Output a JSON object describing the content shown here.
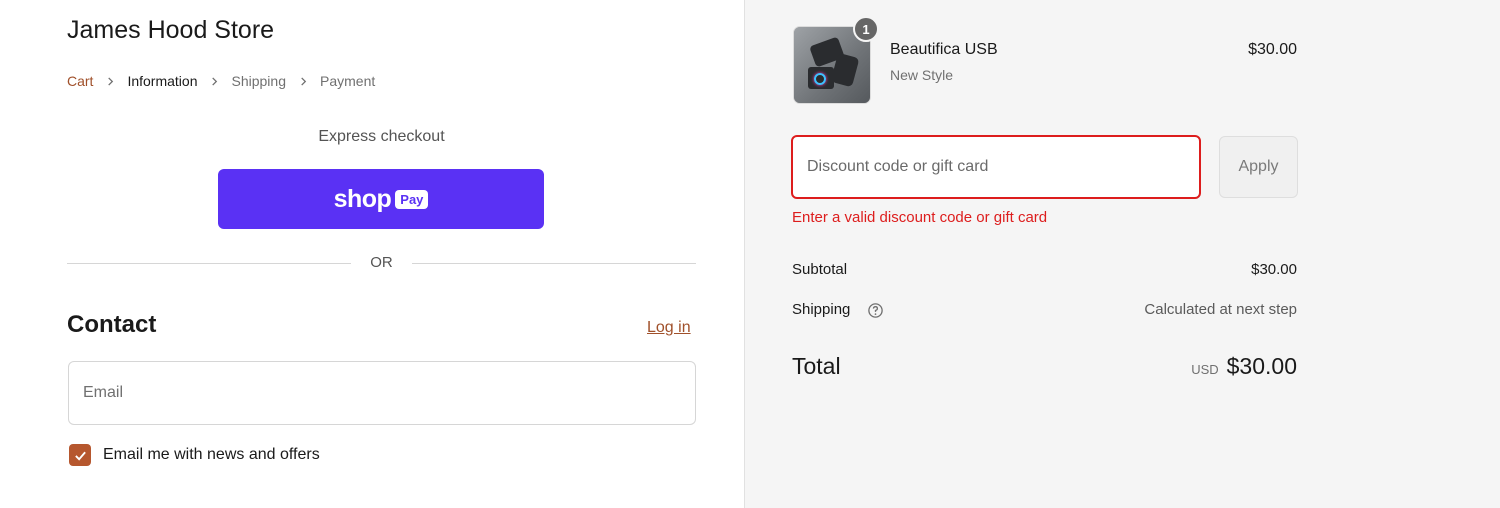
{
  "store": {
    "title": "James Hood Store"
  },
  "breadcrumb": {
    "items": [
      {
        "label": "Cart"
      },
      {
        "label": "Information"
      },
      {
        "label": "Shipping"
      },
      {
        "label": "Payment"
      }
    ]
  },
  "express": {
    "label": "Express checkout",
    "shop_word": "shop",
    "pay_badge": "Pay",
    "divider_text": "OR"
  },
  "contact": {
    "heading": "Contact",
    "login_label": "Log in",
    "email_placeholder": "Email",
    "email_value": "",
    "newsletter_label": "Email me with news and offers",
    "newsletter_checked": true
  },
  "order": {
    "item": {
      "quantity": "1",
      "name": "Beautifica USB",
      "variant": "New Style",
      "price": "$30.00"
    },
    "discount": {
      "placeholder": "Discount code or gift card",
      "value": "",
      "apply_label": "Apply",
      "error": "Enter a valid discount code or gift card"
    },
    "summary": {
      "subtotal_label": "Subtotal",
      "subtotal_value": "$30.00",
      "shipping_label": "Shipping",
      "shipping_value": "Calculated at next step",
      "total_label": "Total",
      "total_currency": "USD",
      "total_value": "$30.00"
    }
  },
  "colors": {
    "accent_link": "#a0502a",
    "checkbox": "#b6572e",
    "shop_pay": "#5a31f4",
    "error": "#dd1d1d"
  }
}
